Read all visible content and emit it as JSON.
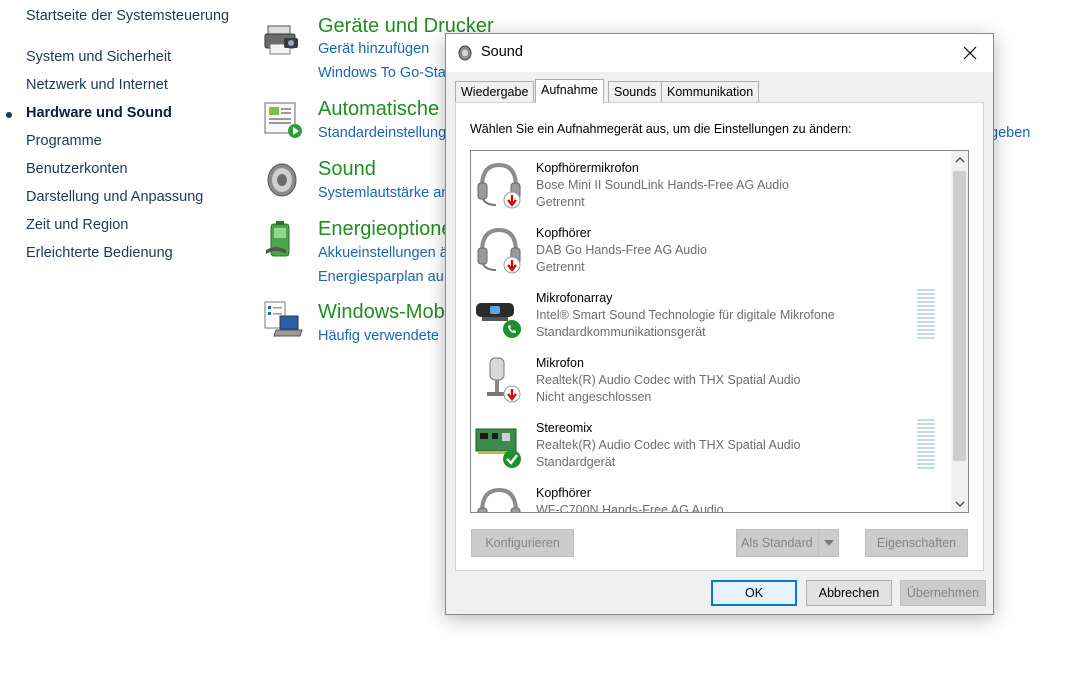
{
  "nav": {
    "items": [
      {
        "label": "Startseite der Systemsteuerung",
        "active": false
      },
      {
        "label": "System und Sicherheit",
        "active": false
      },
      {
        "label": "Netzwerk und Internet",
        "active": false
      },
      {
        "label": "Hardware und Sound",
        "active": true
      },
      {
        "label": "Programme",
        "active": false
      },
      {
        "label": "Benutzerkonten",
        "active": false
      },
      {
        "label": "Darstellung und Anpassung",
        "active": false
      },
      {
        "label": "Zeit und Region",
        "active": false
      },
      {
        "label": "Erleichterte Bedienung",
        "active": false
      }
    ]
  },
  "categories": [
    {
      "title": "Geräte und Drucker",
      "links": [
        "Gerät hinzufügen",
        "Windows To Go-Sta"
      ],
      "icon": "printer-icon"
    },
    {
      "title": "Automatische W",
      "links": [
        "Standardeinstellung"
      ],
      "icon": "autoplay-icon"
    },
    {
      "title": "Sound",
      "links": [
        "Systemlautstärke an"
      ],
      "icon": "speaker-icon"
    },
    {
      "title": "Energieoptione",
      "links": [
        "Akkueinstellungen ä",
        "Energiesparplan au"
      ],
      "icon": "battery-icon"
    },
    {
      "title": "Windows-Mob",
      "links": [
        "Häufig verwendete"
      ],
      "icon": "mobility-center-icon"
    }
  ],
  "background_link": "geben",
  "dialog": {
    "title": "Sound",
    "tabs": [
      {
        "label": "Wiedergabe",
        "active": false
      },
      {
        "label": "Aufnahme",
        "active": true
      },
      {
        "label": "Sounds",
        "active": false
      },
      {
        "label": "Kommunikation",
        "active": false
      }
    ],
    "instruction": "Wählen Sie ein Aufnahmegerät aus, um die Einstellungen zu ändern:",
    "devices": [
      {
        "name": "Kopfhörermikrofon",
        "desc": "Bose Mini II SoundLink Hands-Free AG Audio",
        "status": "Getrennt",
        "icon": "headset-icon",
        "badge": "disconnected",
        "meter": false
      },
      {
        "name": "Kopfhörer",
        "desc": "DAB Go Hands-Free AG Audio",
        "status": "Getrennt",
        "icon": "headset-icon",
        "badge": "disconnected",
        "meter": false
      },
      {
        "name": "Mikrofonarray",
        "desc": "Intel® Smart Sound Technologie für digitale Mikrofone",
        "status": "Standardkommunikationsgerät",
        "icon": "microphone-array-icon",
        "badge": "communication",
        "meter": true
      },
      {
        "name": "Mikrofon",
        "desc": "Realtek(R) Audio Codec with THX Spatial Audio",
        "status": "Nicht angeschlossen",
        "icon": "microphone-icon",
        "badge": "disconnected",
        "meter": false
      },
      {
        "name": "Stereomix",
        "desc": "Realtek(R) Audio Codec with THX Spatial Audio",
        "status": "Standardgerät",
        "icon": "sound-card-icon",
        "badge": "default",
        "meter": true
      },
      {
        "name": "Kopfhörer",
        "desc": "WF-C700N Hands-Free AG Audio",
        "status": "",
        "icon": "headset-icon",
        "badge": "none",
        "meter": false
      }
    ],
    "buttons": {
      "configure": "Konfigurieren",
      "set_default": "Als Standard",
      "properties": "Eigenschaften",
      "ok": "OK",
      "cancel": "Abbrechen",
      "apply": "Übernehmen"
    }
  },
  "colors": {
    "category_title": "#218c21",
    "link": "#1a66b3",
    "nav_text": "#1e3955",
    "focus_border": "#0078d7"
  }
}
